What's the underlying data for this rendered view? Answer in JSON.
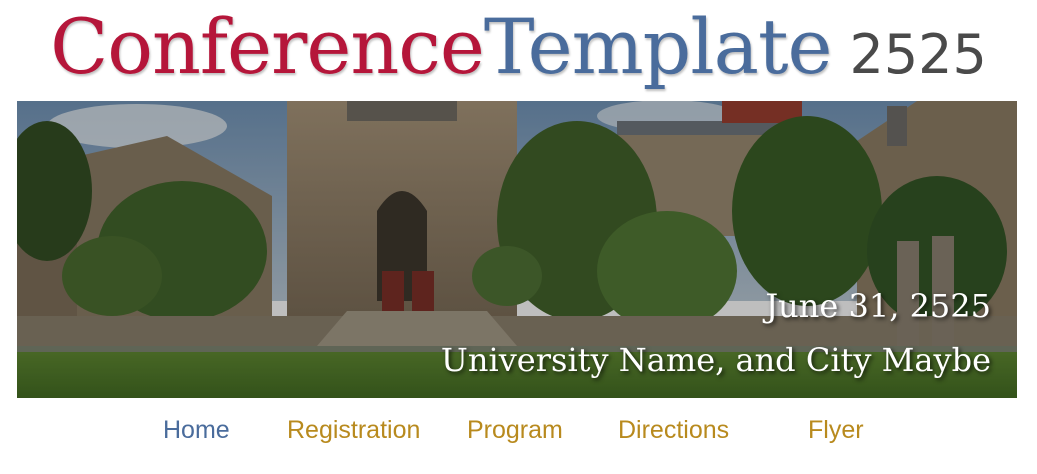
{
  "header": {
    "title_part_1": "Conference",
    "title_part_2": "Template",
    "title_year": "2525"
  },
  "banner": {
    "date": "June 31, 2525",
    "location": "University Name, and City Maybe"
  },
  "nav": {
    "items": [
      {
        "label": "Home",
        "active": true
      },
      {
        "label": "Registration",
        "active": false
      },
      {
        "label": "Program",
        "active": false
      },
      {
        "label": "Directions",
        "active": false
      },
      {
        "label": "Flyer",
        "active": false
      }
    ]
  },
  "colors": {
    "title_red": "#b5163a",
    "title_blue": "#4a6c9c",
    "year_gray": "#4a4a4a",
    "nav_active": "#4a6c9c",
    "nav_inactive": "#b88a1e"
  }
}
